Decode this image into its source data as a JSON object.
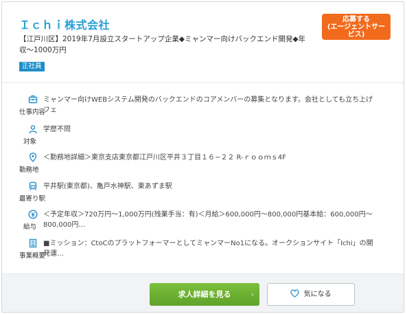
{
  "company": {
    "name": "Ｉｃｈｉ株式会社",
    "summary": "【江戸川区】2019年7月設立スタートアップ企業◆ミャンマー向けバックエンド開発◆年収〜1000万円",
    "employment_badge": "正社員"
  },
  "apply_button": "応募する\n(エージェントサービス)",
  "details": [
    {
      "icon": "briefcase-icon",
      "label": "仕事内容",
      "text": "ミャンマー向けWEBシステム開発のバックエンドのコアメンバーの募集となります。会社としても立ち上げフェ"
    },
    {
      "icon": "person-icon",
      "label": "対象",
      "text": "学歴不問"
    },
    {
      "icon": "location-pin-icon",
      "label": "勤務地",
      "text": "＜勤務地詳細＞東京支店東京都江戸川区平井３丁目１６−２２ R-ｒｏｏｍｓ4F"
    },
    {
      "icon": "train-icon",
      "label": "最寄り駅",
      "text": "平井駅(東京都)、亀戸水神駅、東あずま駅"
    },
    {
      "icon": "yen-icon",
      "label": "給与",
      "text": "＜予定年収＞720万円〜1,000万円(残業手当：有)＜月給＞600,000円〜800,000円基本給：600,000円〜800,000円…"
    },
    {
      "icon": "building-icon",
      "label": "事業概要",
      "text": "■ミッション：CtoCのプラットフォーマーとしてミャンマーNo1になる。オークションサイト「Ichi」の開発運…"
    }
  ],
  "footer": {
    "detail_button": "求人詳細を見る",
    "detail_chevron": "›",
    "favorite_button": "気になる"
  },
  "colors": {
    "company_name": "#2a9fd6",
    "apply_button": "#f26b1d",
    "badge": "#1e8fc9",
    "detail_button": "#6db032",
    "icon": "#2a8fc9"
  }
}
